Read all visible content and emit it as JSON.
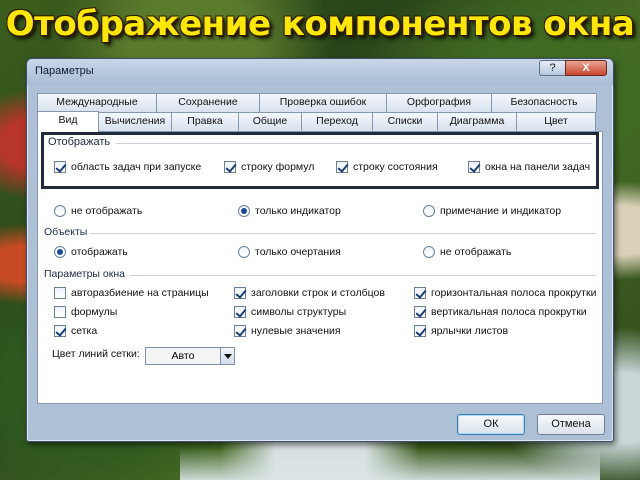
{
  "headline": "Отображение компонентов окна",
  "window": {
    "title": "Параметры",
    "help_label": "?",
    "close_label": "X"
  },
  "tabs_row1": [
    {
      "label": "Международные"
    },
    {
      "label": "Сохранение"
    },
    {
      "label": "Проверка ошибок"
    },
    {
      "label": "Орфография"
    },
    {
      "label": "Безопасность"
    }
  ],
  "tabs_row2": [
    {
      "label": "Вид",
      "active": true
    },
    {
      "label": "Вычисления"
    },
    {
      "label": "Правка"
    },
    {
      "label": "Общие"
    },
    {
      "label": "Переход"
    },
    {
      "label": "Списки"
    },
    {
      "label": "Диаграмма"
    },
    {
      "label": "Цвет"
    }
  ],
  "display": {
    "title": "Отображать",
    "items": [
      {
        "label": "область задач при запуске",
        "checked": true
      },
      {
        "label": "строку формул",
        "checked": true
      },
      {
        "label": "строку состояния",
        "checked": true
      },
      {
        "label": "окна на панели задач",
        "checked": true
      }
    ]
  },
  "notes": {
    "items": [
      {
        "label": "не отображать",
        "selected": false
      },
      {
        "label": "только индикатор",
        "selected": true
      },
      {
        "label": "примечание и индикатор",
        "selected": false
      }
    ]
  },
  "objects": {
    "title": "Объекты",
    "items": [
      {
        "label": "отображать",
        "selected": true
      },
      {
        "label": "только очертания",
        "selected": false
      },
      {
        "label": "не отображать",
        "selected": false
      }
    ]
  },
  "window_params": {
    "title": "Параметры окна",
    "col1": [
      {
        "label": "авторазбиение на страницы",
        "checked": false
      },
      {
        "label": "формулы",
        "checked": false
      },
      {
        "label": "сетка",
        "checked": true
      }
    ],
    "col2": [
      {
        "label": "заголовки строк и столбцов",
        "checked": true
      },
      {
        "label": "символы структуры",
        "checked": true
      },
      {
        "label": "нулевые значения",
        "checked": true
      }
    ],
    "col3": [
      {
        "label": "горизонтальная полоса прокрутки",
        "checked": true
      },
      {
        "label": "вертикальная полоса прокрутки",
        "checked": true
      },
      {
        "label": "ярлычки листов",
        "checked": true
      }
    ],
    "grid_color_label": "Цвет линий сетки:",
    "grid_color_value": "Авто"
  },
  "buttons": {
    "ok": "ОК",
    "cancel": "Отмена"
  }
}
